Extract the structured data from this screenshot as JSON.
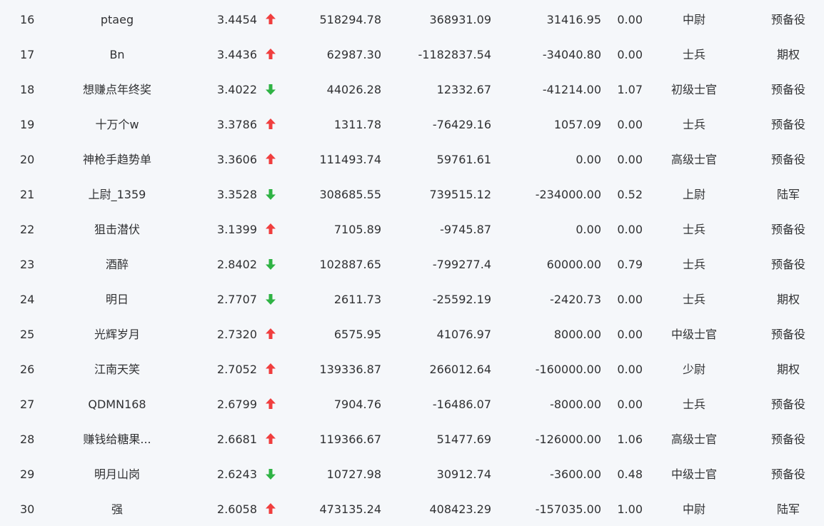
{
  "colors": {
    "up": "#f03e3e",
    "down": "#2fb344",
    "text": "#303133",
    "background": "#f5f7fa"
  },
  "rows": [
    {
      "rank": "16",
      "name": "ptaeg",
      "ratio": "3.4454",
      "trend": "up",
      "v1": "518294.78",
      "v2": "368931.09",
      "v3": "31416.95",
      "v4": "0.00",
      "title": "中尉",
      "category": "预备役"
    },
    {
      "rank": "17",
      "name": "Bn",
      "ratio": "3.4436",
      "trend": "up",
      "v1": "62987.30",
      "v2": "-1182837.54",
      "v3": "-34040.80",
      "v4": "0.00",
      "title": "士兵",
      "category": "期权"
    },
    {
      "rank": "18",
      "name": "想赚点年终奖",
      "ratio": "3.4022",
      "trend": "down",
      "v1": "44026.28",
      "v2": "12332.67",
      "v3": "-41214.00",
      "v4": "1.07",
      "title": "初级士官",
      "category": "预备役"
    },
    {
      "rank": "19",
      "name": "十万个w",
      "ratio": "3.3786",
      "trend": "up",
      "v1": "1311.78",
      "v2": "-76429.16",
      "v3": "1057.09",
      "v4": "0.00",
      "title": "士兵",
      "category": "预备役"
    },
    {
      "rank": "20",
      "name": "神枪手趋势单",
      "ratio": "3.3606",
      "trend": "up",
      "v1": "111493.74",
      "v2": "59761.61",
      "v3": "0.00",
      "v4": "0.00",
      "title": "高级士官",
      "category": "预备役"
    },
    {
      "rank": "21",
      "name": "上尉_1359",
      "ratio": "3.3528",
      "trend": "down",
      "v1": "308685.55",
      "v2": "739515.12",
      "v3": "-234000.00",
      "v4": "0.52",
      "title": "上尉",
      "category": "陆军"
    },
    {
      "rank": "22",
      "name": "狙击潜伏",
      "ratio": "3.1399",
      "trend": "up",
      "v1": "7105.89",
      "v2": "-9745.87",
      "v3": "0.00",
      "v4": "0.00",
      "title": "士兵",
      "category": "预备役"
    },
    {
      "rank": "23",
      "name": "酒醉",
      "ratio": "2.8402",
      "trend": "down",
      "v1": "102887.65",
      "v2": "-799277.4",
      "v3": "60000.00",
      "v4": "0.79",
      "title": "士兵",
      "category": "预备役"
    },
    {
      "rank": "24",
      "name": "明日",
      "ratio": "2.7707",
      "trend": "down",
      "v1": "2611.73",
      "v2": "-25592.19",
      "v3": "-2420.73",
      "v4": "0.00",
      "title": "士兵",
      "category": "期权"
    },
    {
      "rank": "25",
      "name": "光辉岁月",
      "ratio": "2.7320",
      "trend": "up",
      "v1": "6575.95",
      "v2": "41076.97",
      "v3": "8000.00",
      "v4": "0.00",
      "title": "中级士官",
      "category": "预备役"
    },
    {
      "rank": "26",
      "name": "江南天笑",
      "ratio": "2.7052",
      "trend": "up",
      "v1": "139336.87",
      "v2": "266012.64",
      "v3": "-160000.00",
      "v4": "0.00",
      "title": "少尉",
      "category": "期权"
    },
    {
      "rank": "27",
      "name": "QDMN168",
      "ratio": "2.6799",
      "trend": "up",
      "v1": "7904.76",
      "v2": "-16486.07",
      "v3": "-8000.00",
      "v4": "0.00",
      "title": "士兵",
      "category": "预备役"
    },
    {
      "rank": "28",
      "name": "赚钱给糖果...",
      "ratio": "2.6681",
      "trend": "up",
      "v1": "119366.67",
      "v2": "51477.69",
      "v3": "-126000.00",
      "v4": "1.06",
      "title": "高级士官",
      "category": "预备役"
    },
    {
      "rank": "29",
      "name": "明月山岗",
      "ratio": "2.6243",
      "trend": "down",
      "v1": "10727.98",
      "v2": "30912.74",
      "v3": "-3600.00",
      "v4": "0.48",
      "title": "中级士官",
      "category": "预备役"
    },
    {
      "rank": "30",
      "name": "强",
      "ratio": "2.6058",
      "trend": "up",
      "v1": "473135.24",
      "v2": "408423.29",
      "v3": "-157035.00",
      "v4": "1.00",
      "title": "中尉",
      "category": "陆军"
    }
  ]
}
